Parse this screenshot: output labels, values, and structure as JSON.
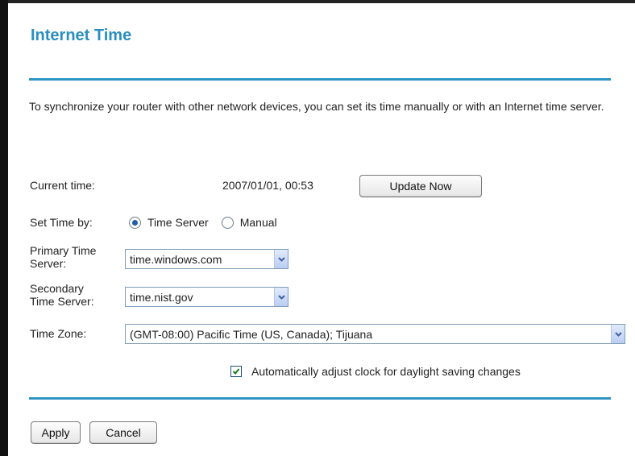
{
  "page": {
    "title": "Internet Time",
    "description": "To synchronize your router with other network devices, you can set its time manually or with an Internet time server."
  },
  "current_time": {
    "label": "Current time:",
    "value": "2007/01/01, 00:53",
    "update_button": "Update Now"
  },
  "set_time_by": {
    "label": "Set Time by:",
    "options": [
      {
        "label": "Time Server",
        "selected": true
      },
      {
        "label": "Manual",
        "selected": false
      }
    ]
  },
  "primary_server": {
    "label_line1": "Primary Time",
    "label_line2": "Server:",
    "value": "time.windows.com"
  },
  "secondary_server": {
    "label_line1": "Secondary",
    "label_line2": "Time Server:",
    "value": "time.nist.gov"
  },
  "time_zone": {
    "label": "Time Zone:",
    "value": "(GMT-08:00) Pacific Time (US, Canada); Tijuana"
  },
  "daylight_saving": {
    "label": "Automatically adjust clock for daylight saving changes",
    "checked": true
  },
  "actions": {
    "apply": "Apply",
    "cancel": "Cancel"
  },
  "colors": {
    "title": "#2a8fbf",
    "rule": "#2f95c5"
  },
  "icons": {
    "dropdown": "chevron-down-icon",
    "check": "check-icon"
  }
}
